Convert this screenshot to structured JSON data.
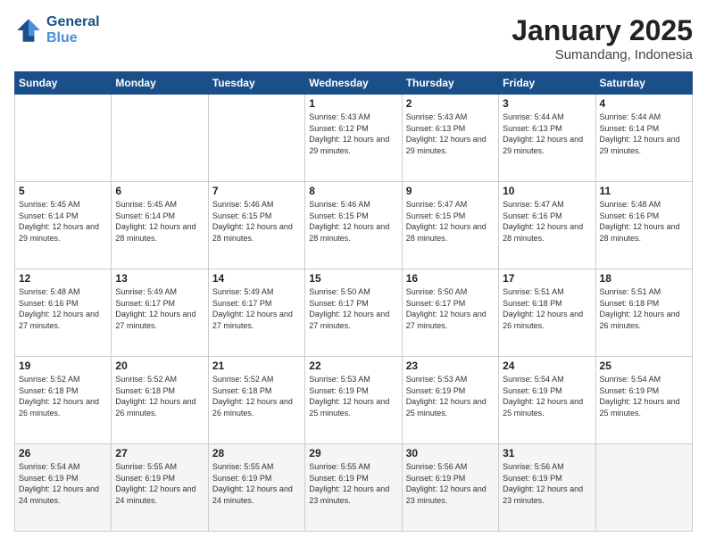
{
  "header": {
    "logo_line1": "General",
    "logo_line2": "Blue",
    "month": "January 2025",
    "location": "Sumandang, Indonesia"
  },
  "weekdays": [
    "Sunday",
    "Monday",
    "Tuesday",
    "Wednesday",
    "Thursday",
    "Friday",
    "Saturday"
  ],
  "weeks": [
    [
      {
        "day": "",
        "sunrise": "",
        "sunset": "",
        "daylight": ""
      },
      {
        "day": "",
        "sunrise": "",
        "sunset": "",
        "daylight": ""
      },
      {
        "day": "",
        "sunrise": "",
        "sunset": "",
        "daylight": ""
      },
      {
        "day": "1",
        "sunrise": "Sunrise: 5:43 AM",
        "sunset": "Sunset: 6:12 PM",
        "daylight": "Daylight: 12 hours and 29 minutes."
      },
      {
        "day": "2",
        "sunrise": "Sunrise: 5:43 AM",
        "sunset": "Sunset: 6:13 PM",
        "daylight": "Daylight: 12 hours and 29 minutes."
      },
      {
        "day": "3",
        "sunrise": "Sunrise: 5:44 AM",
        "sunset": "Sunset: 6:13 PM",
        "daylight": "Daylight: 12 hours and 29 minutes."
      },
      {
        "day": "4",
        "sunrise": "Sunrise: 5:44 AM",
        "sunset": "Sunset: 6:14 PM",
        "daylight": "Daylight: 12 hours and 29 minutes."
      }
    ],
    [
      {
        "day": "5",
        "sunrise": "Sunrise: 5:45 AM",
        "sunset": "Sunset: 6:14 PM",
        "daylight": "Daylight: 12 hours and 29 minutes."
      },
      {
        "day": "6",
        "sunrise": "Sunrise: 5:45 AM",
        "sunset": "Sunset: 6:14 PM",
        "daylight": "Daylight: 12 hours and 28 minutes."
      },
      {
        "day": "7",
        "sunrise": "Sunrise: 5:46 AM",
        "sunset": "Sunset: 6:15 PM",
        "daylight": "Daylight: 12 hours and 28 minutes."
      },
      {
        "day": "8",
        "sunrise": "Sunrise: 5:46 AM",
        "sunset": "Sunset: 6:15 PM",
        "daylight": "Daylight: 12 hours and 28 minutes."
      },
      {
        "day": "9",
        "sunrise": "Sunrise: 5:47 AM",
        "sunset": "Sunset: 6:15 PM",
        "daylight": "Daylight: 12 hours and 28 minutes."
      },
      {
        "day": "10",
        "sunrise": "Sunrise: 5:47 AM",
        "sunset": "Sunset: 6:16 PM",
        "daylight": "Daylight: 12 hours and 28 minutes."
      },
      {
        "day": "11",
        "sunrise": "Sunrise: 5:48 AM",
        "sunset": "Sunset: 6:16 PM",
        "daylight": "Daylight: 12 hours and 28 minutes."
      }
    ],
    [
      {
        "day": "12",
        "sunrise": "Sunrise: 5:48 AM",
        "sunset": "Sunset: 6:16 PM",
        "daylight": "Daylight: 12 hours and 27 minutes."
      },
      {
        "day": "13",
        "sunrise": "Sunrise: 5:49 AM",
        "sunset": "Sunset: 6:17 PM",
        "daylight": "Daylight: 12 hours and 27 minutes."
      },
      {
        "day": "14",
        "sunrise": "Sunrise: 5:49 AM",
        "sunset": "Sunset: 6:17 PM",
        "daylight": "Daylight: 12 hours and 27 minutes."
      },
      {
        "day": "15",
        "sunrise": "Sunrise: 5:50 AM",
        "sunset": "Sunset: 6:17 PM",
        "daylight": "Daylight: 12 hours and 27 minutes."
      },
      {
        "day": "16",
        "sunrise": "Sunrise: 5:50 AM",
        "sunset": "Sunset: 6:17 PM",
        "daylight": "Daylight: 12 hours and 27 minutes."
      },
      {
        "day": "17",
        "sunrise": "Sunrise: 5:51 AM",
        "sunset": "Sunset: 6:18 PM",
        "daylight": "Daylight: 12 hours and 26 minutes."
      },
      {
        "day": "18",
        "sunrise": "Sunrise: 5:51 AM",
        "sunset": "Sunset: 6:18 PM",
        "daylight": "Daylight: 12 hours and 26 minutes."
      }
    ],
    [
      {
        "day": "19",
        "sunrise": "Sunrise: 5:52 AM",
        "sunset": "Sunset: 6:18 PM",
        "daylight": "Daylight: 12 hours and 26 minutes."
      },
      {
        "day": "20",
        "sunrise": "Sunrise: 5:52 AM",
        "sunset": "Sunset: 6:18 PM",
        "daylight": "Daylight: 12 hours and 26 minutes."
      },
      {
        "day": "21",
        "sunrise": "Sunrise: 5:52 AM",
        "sunset": "Sunset: 6:18 PM",
        "daylight": "Daylight: 12 hours and 26 minutes."
      },
      {
        "day": "22",
        "sunrise": "Sunrise: 5:53 AM",
        "sunset": "Sunset: 6:19 PM",
        "daylight": "Daylight: 12 hours and 25 minutes."
      },
      {
        "day": "23",
        "sunrise": "Sunrise: 5:53 AM",
        "sunset": "Sunset: 6:19 PM",
        "daylight": "Daylight: 12 hours and 25 minutes."
      },
      {
        "day": "24",
        "sunrise": "Sunrise: 5:54 AM",
        "sunset": "Sunset: 6:19 PM",
        "daylight": "Daylight: 12 hours and 25 minutes."
      },
      {
        "day": "25",
        "sunrise": "Sunrise: 5:54 AM",
        "sunset": "Sunset: 6:19 PM",
        "daylight": "Daylight: 12 hours and 25 minutes."
      }
    ],
    [
      {
        "day": "26",
        "sunrise": "Sunrise: 5:54 AM",
        "sunset": "Sunset: 6:19 PM",
        "daylight": "Daylight: 12 hours and 24 minutes."
      },
      {
        "day": "27",
        "sunrise": "Sunrise: 5:55 AM",
        "sunset": "Sunset: 6:19 PM",
        "daylight": "Daylight: 12 hours and 24 minutes."
      },
      {
        "day": "28",
        "sunrise": "Sunrise: 5:55 AM",
        "sunset": "Sunset: 6:19 PM",
        "daylight": "Daylight: 12 hours and 24 minutes."
      },
      {
        "day": "29",
        "sunrise": "Sunrise: 5:55 AM",
        "sunset": "Sunset: 6:19 PM",
        "daylight": "Daylight: 12 hours and 23 minutes."
      },
      {
        "day": "30",
        "sunrise": "Sunrise: 5:56 AM",
        "sunset": "Sunset: 6:19 PM",
        "daylight": "Daylight: 12 hours and 23 minutes."
      },
      {
        "day": "31",
        "sunrise": "Sunrise: 5:56 AM",
        "sunset": "Sunset: 6:19 PM",
        "daylight": "Daylight: 12 hours and 23 minutes."
      },
      {
        "day": "",
        "sunrise": "",
        "sunset": "",
        "daylight": ""
      }
    ]
  ]
}
